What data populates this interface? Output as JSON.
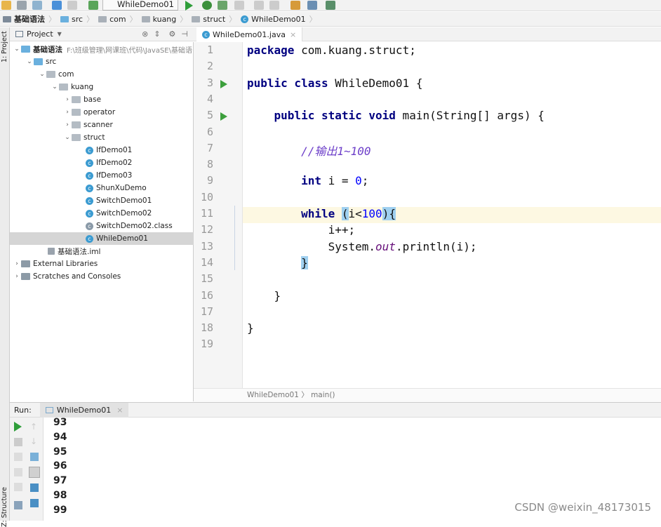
{
  "toolbar": {
    "run_config": "WhileDemo01"
  },
  "breadcrumb": [
    "基础语法",
    "src",
    "com",
    "kuang",
    "struct",
    "WhileDemo01"
  ],
  "left_strip": {
    "project_label": "1: Project",
    "structure_label": "Z: Structure"
  },
  "project_panel": {
    "title": "Project",
    "tree": [
      {
        "label": "基础语法",
        "hint": "F:\\班级管理\\网课班\\代码\\JavaSE\\基础语",
        "level": 0,
        "arrow": "open",
        "icon": "module"
      },
      {
        "label": "src",
        "level": 1,
        "arrow": "open",
        "icon": "source-folder"
      },
      {
        "label": "com",
        "level": 2,
        "arrow": "open",
        "icon": "package"
      },
      {
        "label": "kuang",
        "level": 3,
        "arrow": "open",
        "icon": "package"
      },
      {
        "label": "base",
        "level": 4,
        "arrow": "closed",
        "icon": "package"
      },
      {
        "label": "operator",
        "level": 4,
        "arrow": "closed",
        "icon": "package"
      },
      {
        "label": "scanner",
        "level": 4,
        "arrow": "closed",
        "icon": "package"
      },
      {
        "label": "struct",
        "level": 4,
        "arrow": "open",
        "icon": "package"
      },
      {
        "label": "IfDemo01",
        "level": 5,
        "icon": "class"
      },
      {
        "label": "IfDemo02",
        "level": 5,
        "icon": "class"
      },
      {
        "label": "IfDemo03",
        "level": 5,
        "icon": "class"
      },
      {
        "label": "ShunXuDemo",
        "level": 5,
        "icon": "class"
      },
      {
        "label": "SwitchDemo01",
        "level": 5,
        "icon": "class"
      },
      {
        "label": "SwitchDemo02",
        "level": 5,
        "icon": "class"
      },
      {
        "label": "SwitchDemo02.class",
        "level": 5,
        "icon": "class-file"
      },
      {
        "label": "WhileDemo01",
        "level": 5,
        "icon": "class",
        "selected": true
      },
      {
        "label": "基础语法.iml",
        "level": 2,
        "icon": "iml-file"
      },
      {
        "label": "External Libraries",
        "level": 0,
        "arrow": "closed",
        "icon": "library"
      },
      {
        "label": "Scratches and Consoles",
        "level": 0,
        "arrow": "closed",
        "icon": "scratches"
      }
    ]
  },
  "editor": {
    "tab": "WhileDemo01.java",
    "current_line": 11,
    "lines": [
      [
        [
          "package",
          "kw"
        ],
        [
          " com.kuang.struct;",
          ""
        ]
      ],
      [],
      [
        [
          "public class",
          "kw"
        ],
        [
          " WhileDemo01 {",
          ""
        ]
      ],
      [],
      [
        [
          "    public static void",
          "kw"
        ],
        [
          " main(String[] args) {",
          ""
        ]
      ],
      [],
      [
        [
          "        //输出1~100",
          "cm"
        ]
      ],
      [],
      [
        [
          "        int",
          "kw"
        ],
        [
          " i = ",
          ""
        ],
        [
          "0",
          "num"
        ],
        [
          ";",
          ""
        ]
      ],
      [],
      [
        [
          "        while",
          "kw"
        ],
        [
          " ",
          ""
        ],
        [
          "(",
          "hlb"
        ],
        [
          "i<",
          ""
        ],
        [
          "100",
          "num"
        ],
        [
          ")",
          "hlb"
        ],
        [
          "{",
          "hlb"
        ]
      ],
      [
        [
          "            i++;",
          ""
        ]
      ],
      [
        [
          "            System.",
          ""
        ],
        [
          "out",
          "fld"
        ],
        [
          ".println(i);",
          ""
        ]
      ],
      [
        [
          "        ",
          ""
        ],
        [
          "}",
          "hlb"
        ]
      ],
      [],
      [
        [
          "    }",
          ""
        ]
      ],
      [],
      [
        [
          "}",
          ""
        ]
      ],
      []
    ],
    "run_lines": [
      3,
      5
    ],
    "breadcrumb": [
      "WhileDemo01",
      "main()"
    ]
  },
  "run": {
    "label": "Run:",
    "tab": "WhileDemo01",
    "output": [
      "93",
      "94",
      "95",
      "96",
      "97",
      "98",
      "99"
    ]
  },
  "watermark": "CSDN @weixin_48173015"
}
